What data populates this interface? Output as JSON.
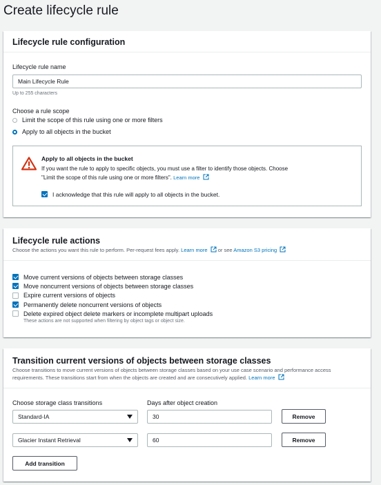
{
  "page": {
    "title": "Create lifecycle rule"
  },
  "config": {
    "title": "Lifecycle rule configuration",
    "name_label": "Lifecycle rule name",
    "name_value": "Main Lifecycle Rule",
    "name_hint": "Up to 255 characters",
    "scope_label": "Choose a rule scope",
    "scope_options": [
      {
        "label": "Limit the scope of this rule using one or more filters",
        "selected": false
      },
      {
        "label": "Apply to all objects in the bucket",
        "selected": true
      }
    ],
    "alert": {
      "title": "Apply to all objects in the bucket",
      "body_line1": "If you want the rule to apply to specific objects, you must use a filter to identify those objects. Choose",
      "body_line2": "\"Limit the scope of this rule using one or more filters\".",
      "learn_more": "Learn more",
      "ack_label": "I acknowledge that this rule will apply to all objects in the bucket.",
      "ack_checked": true,
      "icon": "warning-triangle-icon",
      "icon_color": "#d13212"
    }
  },
  "actions": {
    "title": "Lifecycle rule actions",
    "desc_text": "Choose the actions you want this rule to perform. Per-request fees apply.",
    "learn_more": "Learn more",
    "or_see": "or see",
    "pricing_link": "Amazon S3 pricing",
    "items": [
      {
        "label": "Move current versions of objects between storage classes",
        "checked": true
      },
      {
        "label": "Move noncurrent versions of objects between storage classes",
        "checked": true
      },
      {
        "label": "Expire current versions of objects",
        "checked": false
      },
      {
        "label": "Permanently delete noncurrent versions of objects",
        "checked": true
      },
      {
        "label": "Delete expired object delete markers or incomplete multipart uploads",
        "checked": false
      }
    ],
    "note": "These actions are not supported when filtering by object tags or object size."
  },
  "transition": {
    "title": "Transition current versions of objects between storage classes",
    "desc_line1": "Choose transitions to move current versions of objects between storage classes based on your use case scenario and performance access",
    "desc_line2": "requirements. These transitions start from when the objects are created and are consecutively applied.",
    "learn_more": "Learn more",
    "col_class": "Choose storage class transitions",
    "col_days": "Days after object creation",
    "rows": [
      {
        "storage_class": "Standard-IA",
        "days": "30",
        "remove": "Remove"
      },
      {
        "storage_class": "Glacier Instant Retrieval",
        "days": "60",
        "remove": "Remove"
      }
    ],
    "add_button": "Add transition"
  },
  "colors": {
    "accent": "#0073bb",
    "background": "#f2f3f3",
    "warning": "#d13212"
  }
}
